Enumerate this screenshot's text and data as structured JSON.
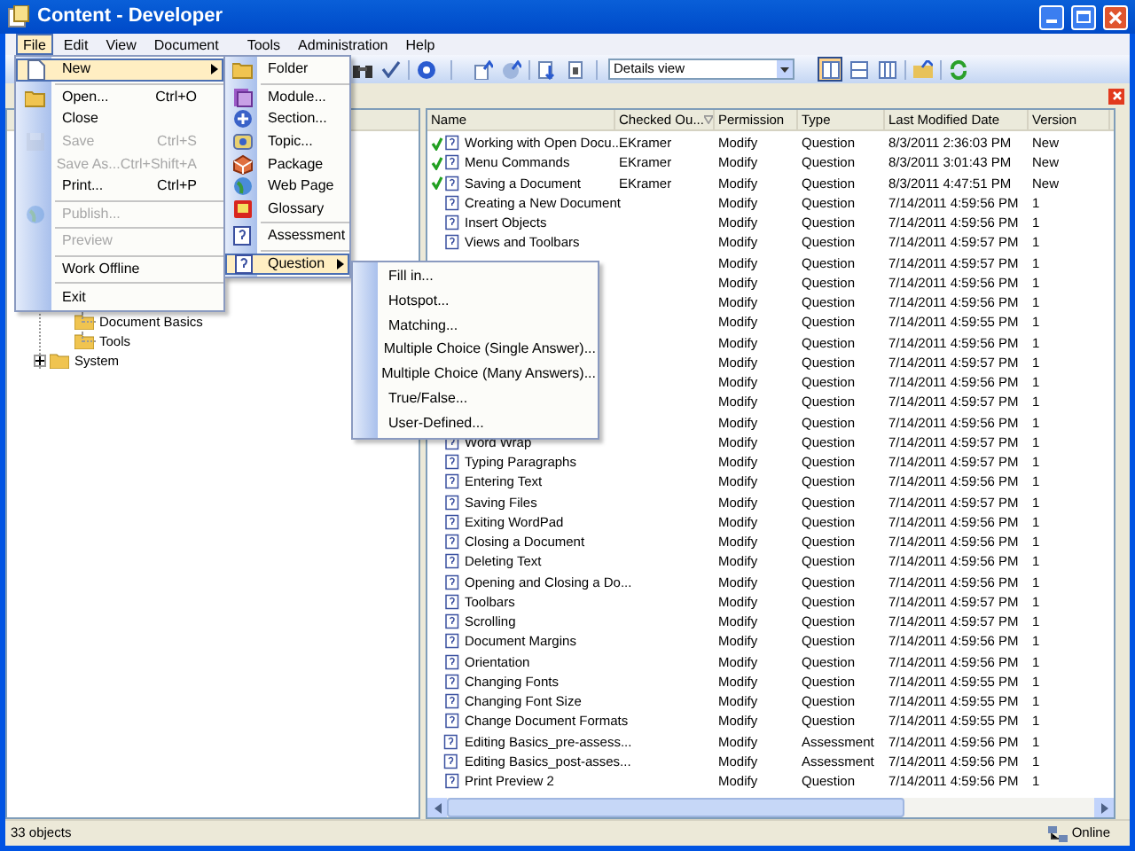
{
  "window": {
    "title": "Content - Developer"
  },
  "menu_bar": [
    {
      "label": "File",
      "selected": true
    },
    {
      "label": "Edit",
      "selected": false
    },
    {
      "label": "View",
      "selected": false
    },
    {
      "label": "Document",
      "selected": false
    },
    {
      "label": "Tools",
      "selected": false
    },
    {
      "label": "Administration",
      "selected": false
    },
    {
      "label": "Help",
      "selected": false
    }
  ],
  "toolbar": {
    "view_select": {
      "value": "Details view"
    },
    "layout_buttons": [
      {
        "selected": true
      },
      {
        "selected": false
      },
      {
        "selected": false
      }
    ]
  },
  "file_menu": [
    {
      "kind": "page",
      "label": "New",
      "selected": true,
      "disabled": false,
      "has_submenu": true
    },
    {
      "kind": "separator"
    },
    {
      "kind": "folder",
      "label": "Open...",
      "shortcut": "Ctrl+O",
      "selected": false,
      "disabled": false,
      "has_submenu": false
    },
    {
      "kind": "plain",
      "label": "Close",
      "selected": false,
      "disabled": false,
      "has_submenu": false
    },
    {
      "kind": "disk",
      "label": "Save",
      "shortcut": "Ctrl+S",
      "selected": false,
      "disabled": true,
      "has_submenu": false
    },
    {
      "kind": "plain",
      "label": "Save As...",
      "shortcut": "Ctrl+Shift+A",
      "selected": false,
      "disabled": true,
      "has_submenu": false
    },
    {
      "kind": "plain",
      "label": "Print...",
      "shortcut": "Ctrl+P",
      "selected": false,
      "disabled": false,
      "has_submenu": false
    },
    {
      "kind": "separator"
    },
    {
      "kind": "globe",
      "label": "Publish...",
      "selected": false,
      "disabled": true,
      "has_submenu": false
    },
    {
      "kind": "separator"
    },
    {
      "kind": "plain",
      "label": "Preview",
      "selected": false,
      "disabled": true,
      "has_submenu": false
    },
    {
      "kind": "separator"
    },
    {
      "kind": "plain",
      "label": "Work Offline",
      "selected": false,
      "disabled": false,
      "has_submenu": false
    },
    {
      "kind": "separator"
    },
    {
      "kind": "plain",
      "label": "Exit",
      "selected": false,
      "disabled": false,
      "has_submenu": false
    }
  ],
  "new_menu": [
    {
      "kind": "folder",
      "label": "Folder",
      "selected": false,
      "has_submenu": false
    },
    {
      "kind": "separator"
    },
    {
      "kind": "module",
      "label": "Module...",
      "selected": false,
      "has_submenu": false
    },
    {
      "kind": "section",
      "label": "Section...",
      "selected": false,
      "has_submenu": false
    },
    {
      "kind": "topic",
      "label": "Topic...",
      "selected": false,
      "has_submenu": false
    },
    {
      "kind": "package",
      "label": "Package",
      "selected": false,
      "has_submenu": false
    },
    {
      "kind": "globe",
      "label": "Web Page",
      "selected": false,
      "has_submenu": false
    },
    {
      "kind": "book",
      "label": "Glossary",
      "selected": false,
      "has_submenu": false
    },
    {
      "kind": "separator"
    },
    {
      "kind": "assessment",
      "label": "Assessment",
      "selected": false,
      "has_submenu": false
    },
    {
      "kind": "separator"
    },
    {
      "kind": "question",
      "label": "Question",
      "selected": true,
      "has_submenu": true
    }
  ],
  "question_menu": [
    {
      "label": "Fill in..."
    },
    {
      "label": "Hotspot..."
    },
    {
      "label": "Matching..."
    },
    {
      "label": "Multiple Choice (Single Answer)..."
    },
    {
      "label": "Multiple Choice (Many Answers)..."
    },
    {
      "label": "True/False..."
    },
    {
      "label": "User-Defined..."
    }
  ],
  "tree": [
    {
      "children": [
        {
          "label": "Document Basics"
        },
        {
          "label": "Tools"
        }
      ]
    },
    {
      "label": "System",
      "expanded": false
    }
  ],
  "table": {
    "columns": [
      {
        "label": "Name",
        "sorted": false
      },
      {
        "label": "Checked Ou...",
        "sorted": true
      },
      {
        "label": "Permission",
        "sorted": false
      },
      {
        "label": "Type",
        "sorted": false
      },
      {
        "label": "Last Modified Date",
        "sorted": false
      },
      {
        "label": "Version",
        "sorted": false
      }
    ],
    "rows": [
      {
        "checked_out": true,
        "kind": "question",
        "name": "Working with Open Docu...",
        "checked_out_by": "EKramer",
        "permission": "Modify",
        "type": "Question",
        "last_modified": "8/3/2011 2:36:03 PM",
        "version": "New"
      },
      {
        "checked_out": true,
        "kind": "question",
        "name": "Menu Commands",
        "checked_out_by": "EKramer",
        "permission": "Modify",
        "type": "Question",
        "last_modified": "8/3/2011 3:01:43 PM",
        "version": "New"
      },
      {
        "checked_out": true,
        "kind": "question",
        "name": "Saving a Document",
        "checked_out_by": "EKramer",
        "permission": "Modify",
        "type": "Question",
        "last_modified": "8/3/2011 4:47:51 PM",
        "version": "New"
      },
      {
        "checked_out": false,
        "kind": "question",
        "name": "Creating a New Document",
        "permission": "Modify",
        "type": "Question",
        "last_modified": "7/14/2011 4:59:56 PM",
        "version": "1"
      },
      {
        "checked_out": false,
        "kind": "question",
        "name": "Insert Objects",
        "permission": "Modify",
        "type": "Question",
        "last_modified": "7/14/2011 4:59:56 PM",
        "version": "1"
      },
      {
        "checked_out": false,
        "kind": "question",
        "name": "Views and Toolbars",
        "permission": "Modify",
        "type": "Question",
        "last_modified": "7/14/2011 4:59:57 PM",
        "version": "1"
      },
      {
        "permission": "Modify",
        "type": "Question",
        "last_modified": "7/14/2011 4:59:57 PM",
        "version": "1"
      },
      {
        "permission": "Modify",
        "type": "Question",
        "last_modified": "7/14/2011 4:59:56 PM",
        "version": "1"
      },
      {
        "permission": "Modify",
        "type": "Question",
        "last_modified": "7/14/2011 4:59:56 PM",
        "version": "1"
      },
      {
        "permission": "Modify",
        "type": "Question",
        "last_modified": "7/14/2011 4:59:55 PM",
        "version": "1"
      },
      {
        "permission": "Modify",
        "type": "Question",
        "last_modified": "7/14/2011 4:59:56 PM",
        "version": "1"
      },
      {
        "permission": "Modify",
        "type": "Question",
        "last_modified": "7/14/2011 4:59:57 PM",
        "version": "1"
      },
      {
        "permission": "Modify",
        "type": "Question",
        "last_modified": "7/14/2011 4:59:56 PM",
        "version": "1"
      },
      {
        "permission": "Modify",
        "type": "Question",
        "last_modified": "7/14/2011 4:59:57 PM",
        "version": "1"
      },
      {
        "permission": "Modify",
        "type": "Question",
        "last_modified": "7/14/2011 4:59:56 PM",
        "version": "1"
      },
      {
        "checked_out": false,
        "kind": "question",
        "name": "Word Wrap",
        "permission": "Modify",
        "type": "Question",
        "last_modified": "7/14/2011 4:59:57 PM",
        "version": "1"
      },
      {
        "checked_out": false,
        "kind": "question",
        "name": "Typing Paragraphs",
        "permission": "Modify",
        "type": "Question",
        "last_modified": "7/14/2011 4:59:57 PM",
        "version": "1"
      },
      {
        "checked_out": false,
        "kind": "question",
        "name": "Entering Text",
        "permission": "Modify",
        "type": "Question",
        "last_modified": "7/14/2011 4:59:56 PM",
        "version": "1"
      },
      {
        "checked_out": false,
        "kind": "question",
        "name": "Saving Files",
        "permission": "Modify",
        "type": "Question",
        "last_modified": "7/14/2011 4:59:57 PM",
        "version": "1"
      },
      {
        "checked_out": false,
        "kind": "question",
        "name": "Exiting WordPad",
        "permission": "Modify",
        "type": "Question",
        "last_modified": "7/14/2011 4:59:56 PM",
        "version": "1"
      },
      {
        "checked_out": false,
        "kind": "question",
        "name": "Closing a Document",
        "permission": "Modify",
        "type": "Question",
        "last_modified": "7/14/2011 4:59:56 PM",
        "version": "1"
      },
      {
        "checked_out": false,
        "kind": "question",
        "name": "Deleting Text",
        "permission": "Modify",
        "type": "Question",
        "last_modified": "7/14/2011 4:59:56 PM",
        "version": "1"
      },
      {
        "checked_out": false,
        "kind": "question",
        "name": "Opening and Closing a Do...",
        "permission": "Modify",
        "type": "Question",
        "last_modified": "7/14/2011 4:59:56 PM",
        "version": "1"
      },
      {
        "checked_out": false,
        "kind": "question",
        "name": "Toolbars",
        "permission": "Modify",
        "type": "Question",
        "last_modified": "7/14/2011 4:59:57 PM",
        "version": "1"
      },
      {
        "checked_out": false,
        "kind": "question",
        "name": "Scrolling",
        "permission": "Modify",
        "type": "Question",
        "last_modified": "7/14/2011 4:59:57 PM",
        "version": "1"
      },
      {
        "checked_out": false,
        "kind": "question",
        "name": "Document Margins",
        "permission": "Modify",
        "type": "Question",
        "last_modified": "7/14/2011 4:59:56 PM",
        "version": "1"
      },
      {
        "checked_out": false,
        "kind": "question",
        "name": "Orientation",
        "permission": "Modify",
        "type": "Question",
        "last_modified": "7/14/2011 4:59:56 PM",
        "version": "1"
      },
      {
        "checked_out": false,
        "kind": "question",
        "name": "Changing Fonts",
        "permission": "Modify",
        "type": "Question",
        "last_modified": "7/14/2011 4:59:55 PM",
        "version": "1"
      },
      {
        "checked_out": false,
        "kind": "question",
        "name": "Changing Font Size",
        "permission": "Modify",
        "type": "Question",
        "last_modified": "7/14/2011 4:59:55 PM",
        "version": "1"
      },
      {
        "checked_out": false,
        "kind": "question",
        "name": "Change Document Formats",
        "permission": "Modify",
        "type": "Question",
        "last_modified": "7/14/2011 4:59:55 PM",
        "version": "1"
      },
      {
        "checked_out": false,
        "kind": "assessment",
        "name": "Editing Basics_pre-assess...",
        "permission": "Modify",
        "type": "Assessment",
        "last_modified": "7/14/2011 4:59:56 PM",
        "version": "1"
      },
      {
        "checked_out": false,
        "kind": "assessment",
        "name": "Editing Basics_post-asses...",
        "permission": "Modify",
        "type": "Assessment",
        "last_modified": "7/14/2011 4:59:56 PM",
        "version": "1"
      },
      {
        "checked_out": false,
        "kind": "question",
        "name": "Print Preview 2",
        "permission": "Modify",
        "type": "Question",
        "last_modified": "7/14/2011 4:59:56 PM",
        "version": "1"
      }
    ]
  },
  "status_bar": {
    "count": "33 objects",
    "connection": "Online"
  }
}
